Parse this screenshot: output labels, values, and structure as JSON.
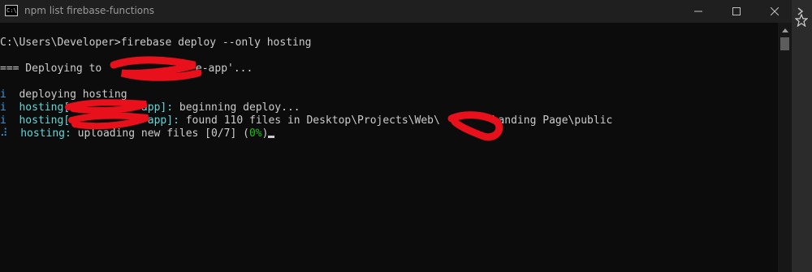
{
  "window": {
    "title": "npm list firebase-functions",
    "app_icon_text": "C:\\"
  },
  "console": {
    "prompt_line": "C:\\Users\\Developer>firebase deploy --only hosting",
    "deploying_prefix": "=== Deploying to '",
    "deploying_suffix": "e-app'...",
    "line1_icon": "i",
    "line1_text": "deploying hosting",
    "line2_icon": "i",
    "line2_label": "hosting[",
    "line2_label_end": "-app]:",
    "line2_text": " beginning deploy...",
    "line3_icon": "i",
    "line3_label": "hosting[",
    "line3_label_end": "e-app]:",
    "line3_text_a": " found 110 files in Desktop\\Projects\\Web\\",
    "line3_text_b": " Landing Page\\public",
    "line4_icon": "⠼",
    "line4_label": "hosting:",
    "line4_text": " uploading new files [0/7] (",
    "line4_percent": "0%",
    "line4_close": ")"
  },
  "colors": {
    "background": "#0c0c0c",
    "text": "#cccccc",
    "info": "#3a96dd",
    "label": "#61d6d6",
    "percent": "#16c60c",
    "redaction": "#e8101a"
  }
}
